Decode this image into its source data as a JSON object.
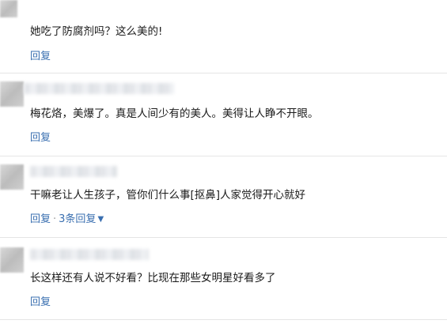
{
  "comments": [
    {
      "text": "她吃了防腐剂吗？这么美的!",
      "reply_label": "回复"
    },
    {
      "text": "梅花烙，美爆了。真是人间少有的美人。美得让人睁不开眼。",
      "reply_label": "回复"
    },
    {
      "text": "干嘛老让人生孩子，管你们什么事[抠鼻]人家觉得开心就好",
      "reply_label": "回复",
      "separator": "·",
      "more_replies_label": "3条回复"
    },
    {
      "text": "长这样还有人说不好看？比现在那些女明星好看多了",
      "reply_label": "回复"
    }
  ]
}
